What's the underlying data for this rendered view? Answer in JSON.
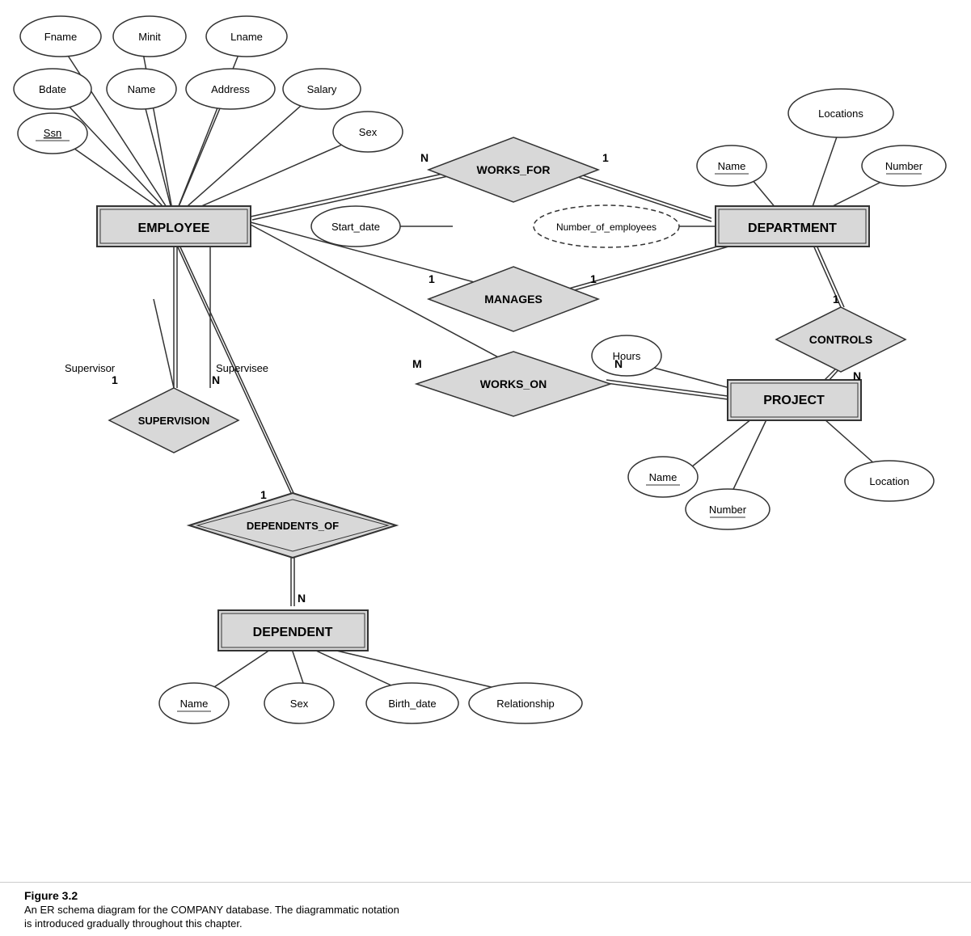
{
  "caption": {
    "title": "Figure 3.2",
    "line1": "An ER schema diagram for the COMPANY database. The diagrammatic notation",
    "line2": "is introduced gradually throughout this chapter."
  },
  "entities": {
    "employee": "EMPLOYEE",
    "department": "DEPARTMENT",
    "project": "PROJECT",
    "dependent": "DEPENDENT"
  },
  "relationships": {
    "works_for": "WORKS_FOR",
    "manages": "MANAGES",
    "works_on": "WORKS_ON",
    "controls": "CONTROLS",
    "supervision": "SUPERVISION",
    "dependents_of": "DEPENDENTS_OF"
  },
  "attributes": {
    "fname": "Fname",
    "minit": "Minit",
    "lname": "Lname",
    "bdate": "Bdate",
    "name": "Name",
    "address": "Address",
    "salary": "Salary",
    "ssn": "Ssn",
    "sex": "Sex",
    "start_date": "Start_date",
    "number_of_employees": "Number_of_employees",
    "locations": "Locations",
    "dept_name": "Name",
    "dept_number": "Number",
    "hours": "Hours",
    "proj_name": "Name",
    "proj_number": "Number",
    "proj_location": "Location",
    "dep_name": "Name",
    "dep_sex": "Sex",
    "birth_date": "Birth_date",
    "relationship": "Relationship"
  },
  "cardinalities": {
    "works_for_employee": "N",
    "works_for_department": "1",
    "manages_employee": "1",
    "manages_department": "1",
    "works_on_employee": "M",
    "works_on_project": "N",
    "controls_department": "1",
    "controls_project": "N",
    "supervision_supervisor": "1",
    "supervision_supervisee": "N",
    "dependents_of_employee": "1",
    "dependents_of_dependent": "N"
  }
}
